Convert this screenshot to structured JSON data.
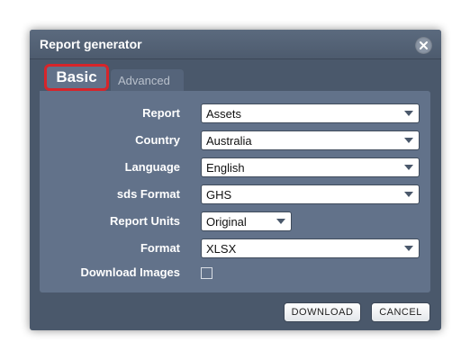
{
  "dialog": {
    "title": "Report generator",
    "close_icon": "close-icon"
  },
  "tabs": [
    {
      "label": "Basic",
      "active": true
    },
    {
      "label": "Advanced",
      "active": false
    }
  ],
  "form": {
    "report": {
      "label": "Report",
      "value": "Assets"
    },
    "country": {
      "label": "Country",
      "value": "Australia"
    },
    "language": {
      "label": "Language",
      "value": "English"
    },
    "sds_format": {
      "label": "sds Format",
      "value": "GHS"
    },
    "report_units": {
      "label": "Report Units",
      "value": "Original"
    },
    "format": {
      "label": "Format",
      "value": "XLSX"
    },
    "download_images": {
      "label": "Download Images",
      "checked": false
    }
  },
  "buttons": {
    "download": "DOWNLOAD",
    "cancel": "CANCEL"
  },
  "colors": {
    "dialog_bg": "#4a586b",
    "panel_bg": "#62728a",
    "highlight": "#d7252a"
  }
}
